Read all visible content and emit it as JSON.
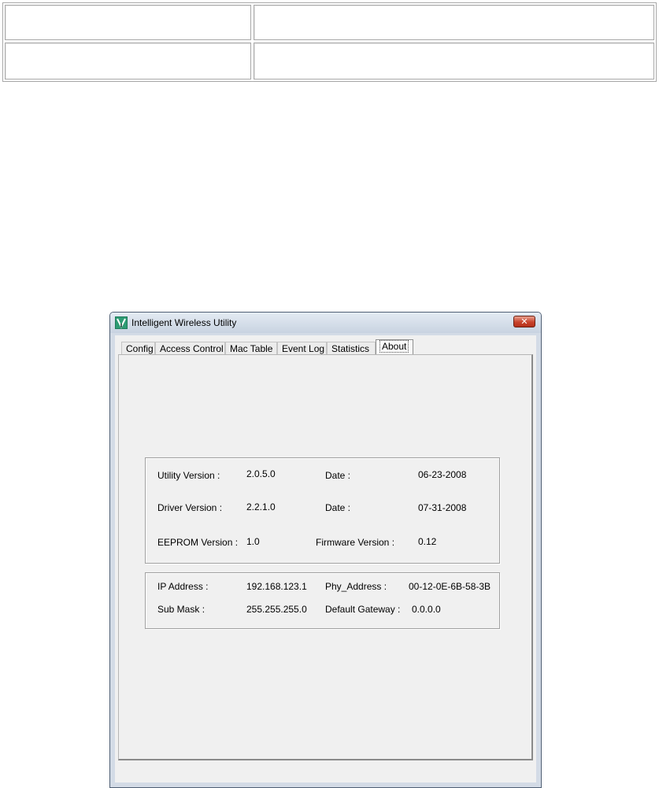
{
  "window": {
    "title": "Intelligent Wireless Utility",
    "close_glyph": "✕"
  },
  "tabs": [
    {
      "label": "Config"
    },
    {
      "label": "Access Control"
    },
    {
      "label": "Mac Table"
    },
    {
      "label": "Event Log"
    },
    {
      "label": "Statistics"
    },
    {
      "label": "About"
    }
  ],
  "active_tab": "About",
  "about": {
    "version_group": {
      "utility_version_label": "Utility Version :",
      "utility_version_value": "2.0.5.0",
      "utility_date_label": "Date :",
      "utility_date_value": "06-23-2008",
      "driver_version_label": "Driver Version :",
      "driver_version_value": "2.2.1.0",
      "driver_date_label": "Date :",
      "driver_date_value": "07-31-2008",
      "eeprom_version_label": "EEPROM Version :",
      "eeprom_version_value": "1.0",
      "firmware_version_label": "Firmware Version :",
      "firmware_version_value": "0.12"
    },
    "network_group": {
      "ip_address_label": "IP Address :",
      "ip_address_value": "192.168.123.1",
      "phy_address_label": "Phy_Address :",
      "phy_address_value": "00-12-0E-6B-58-3B",
      "sub_mask_label": "Sub Mask :",
      "sub_mask_value": "255.255.255.0",
      "default_gateway_label": "Default Gateway :",
      "default_gateway_value": "0.0.0.0"
    }
  },
  "icons": {
    "app": "wireless-utility-icon",
    "close": "close-icon"
  },
  "colors": {
    "close_button": "#c8432b",
    "titlebar": "#d3dbe6",
    "client": "#f0f0f0"
  }
}
